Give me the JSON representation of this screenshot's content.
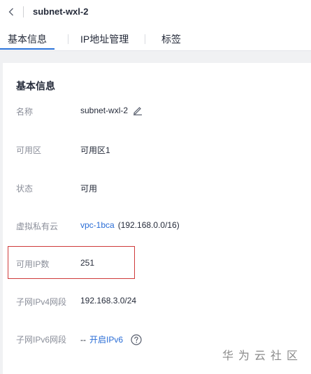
{
  "header": {
    "title": "subnet-wxl-2"
  },
  "tabs": [
    {
      "label": "基本信息"
    },
    {
      "label": "IP地址管理"
    },
    {
      "label": "标签"
    }
  ],
  "section": {
    "title": "基本信息"
  },
  "fields": {
    "name": {
      "label": "名称",
      "value": "subnet-wxl-2"
    },
    "az": {
      "label": "可用区",
      "value": "可用区1"
    },
    "status": {
      "label": "状态",
      "value": "可用"
    },
    "vpc": {
      "label": "虚拟私有云",
      "link": "vpc-1bca",
      "cidr": "(192.168.0.0/16)"
    },
    "available_ips": {
      "label": "可用IP数",
      "value": "251"
    },
    "ipv4": {
      "label": "子网IPv4网段",
      "value": "192.168.3.0/24"
    },
    "ipv6": {
      "label": "子网IPv6网段",
      "value": "--",
      "link": "开启IPv6"
    }
  },
  "watermark": "华为云社区",
  "colors": {
    "accent": "#2a73d9",
    "link": "#2a6dd6",
    "highlight": "#cf3b3b"
  }
}
